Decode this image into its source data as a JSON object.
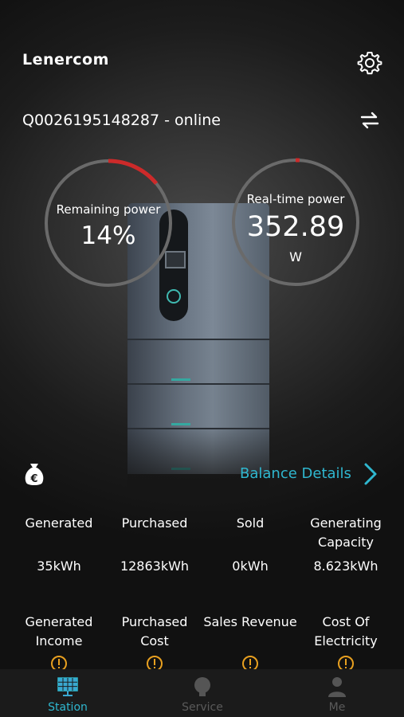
{
  "header": {
    "brand": "Lenercom",
    "settings_icon": "gear-icon"
  },
  "device": {
    "title": "Q0026195148287 - online",
    "switch_icon": "swap-arrows-icon"
  },
  "gauges": {
    "remaining": {
      "label": "Remaining power",
      "value": "14%",
      "fraction": 0.14
    },
    "realtime": {
      "label": "Real-time power",
      "value": "352.89",
      "unit": "W",
      "fraction": 0.01
    }
  },
  "balance": {
    "icon": "money-bag-icon",
    "link_label": "Balance Details"
  },
  "stats": [
    {
      "label": "Generated",
      "value": "35kWh"
    },
    {
      "label": "Purchased",
      "value": "12863kWh"
    },
    {
      "label": "Sold",
      "value": "0kWh"
    },
    {
      "label": "Generating Capacity",
      "value": "8.623kWh"
    }
  ],
  "finance": [
    {
      "label": "Generated Income"
    },
    {
      "label": "Purchased Cost"
    },
    {
      "label": "Sales Revenue"
    },
    {
      "label": "Cost Of Electricity"
    }
  ],
  "nav": {
    "items": [
      {
        "label": "Station",
        "active": true
      },
      {
        "label": "Service",
        "active": false
      },
      {
        "label": "Me",
        "active": false
      }
    ]
  },
  "colors": {
    "accent": "#2fb7cf",
    "gauge_track": "#6a6a6a",
    "gauge_fill": "#cc2a2a",
    "warning": "#e8a020"
  }
}
